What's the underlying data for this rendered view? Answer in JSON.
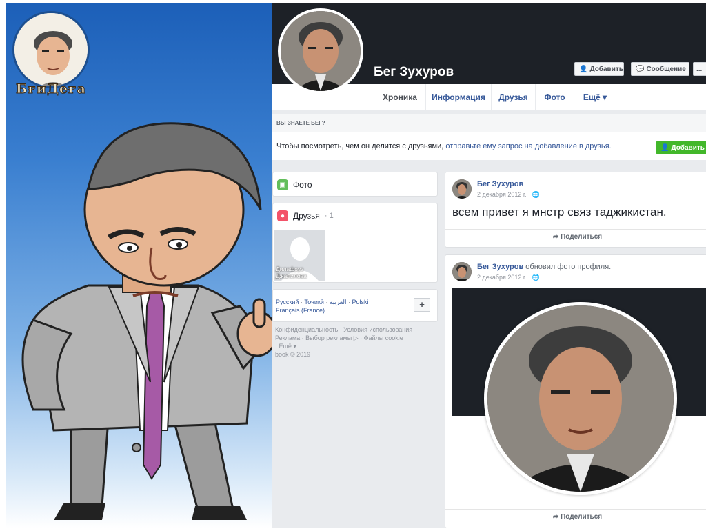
{
  "logo": {
    "text": "БғиДеға"
  },
  "profile": {
    "name": "Бег Зухуров",
    "add_friend_label": "Добавить",
    "message_label": "Сообщение",
    "more_label": "..."
  },
  "tabs": [
    {
      "label": "Хроника"
    },
    {
      "label": "Информация"
    },
    {
      "label": "Друзья"
    },
    {
      "label": "Фото"
    },
    {
      "label": "Ещё ▾"
    }
  ],
  "know_box": {
    "header": "ВЫ ЗНАЕТЕ БЕГ?",
    "text": "Чтобы посмотреть, чем он делится с друзьями,",
    "link": "отправьте ему запрос на добавление в друзья.",
    "button": "Добавить"
  },
  "sidebar": {
    "photos_label": "Фото",
    "friends_label": "Друзья",
    "friends_count": "· 1",
    "friend_name": "Дилафруз Джалилова",
    "languages": [
      "Русский",
      "Тоҷикӣ",
      "العربية",
      "Polski",
      "Français (France)"
    ],
    "lang_add": "+",
    "footer_line1": "Конфиденциальность · Условия использования ·",
    "footer_line2": "Реклама · Выбор рекламы ▷ · Файлы cookie",
    "footer_line3": "· Ещё ▾",
    "copyright": "book © 2019"
  },
  "posts": [
    {
      "author": "Бег Зухуров",
      "action": "",
      "date": "2 декабря 2012 г. ·",
      "text": "всем привет я мнстр связ таджикистан.",
      "share": "Поделиться"
    },
    {
      "author": "Бег Зухуров",
      "action": "обновил фото профиля.",
      "date": "2 декабря 2012 г. ·",
      "share": "Поделиться"
    }
  ],
  "colors": {
    "fb_blue": "#365899",
    "cover": "#1d2127",
    "green": "#42b72a",
    "page_bg": "#e9ebee"
  }
}
